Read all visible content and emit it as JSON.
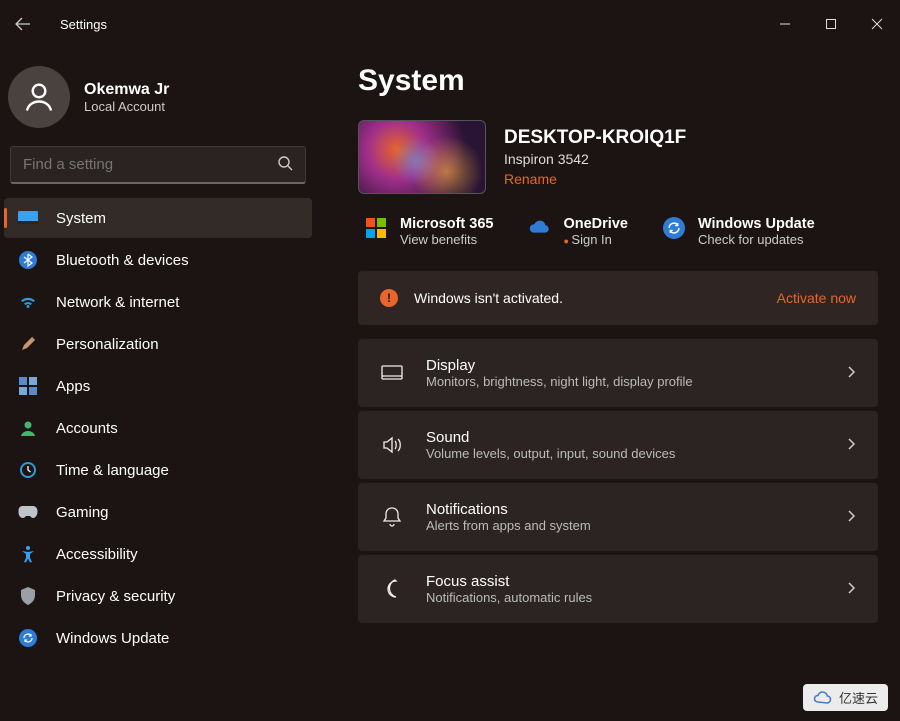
{
  "titlebar": {
    "title": "Settings"
  },
  "profile": {
    "name": "Okemwa Jr",
    "account_type": "Local Account"
  },
  "search": {
    "placeholder": "Find a setting"
  },
  "sidebar": {
    "items": [
      {
        "label": "System"
      },
      {
        "label": "Bluetooth & devices"
      },
      {
        "label": "Network & internet"
      },
      {
        "label": "Personalization"
      },
      {
        "label": "Apps"
      },
      {
        "label": "Accounts"
      },
      {
        "label": "Time & language"
      },
      {
        "label": "Gaming"
      },
      {
        "label": "Accessibility"
      },
      {
        "label": "Privacy & security"
      },
      {
        "label": "Windows Update"
      }
    ],
    "selected_index": 0
  },
  "page": {
    "title": "System"
  },
  "device": {
    "name": "DESKTOP-KROIQ1F",
    "model": "Inspiron 3542",
    "rename_label": "Rename"
  },
  "links": {
    "m365": {
      "title": "Microsoft 365",
      "sub": "View benefits"
    },
    "onedrive": {
      "title": "OneDrive",
      "sub": "Sign In"
    },
    "update": {
      "title": "Windows Update",
      "sub": "Check for updates"
    }
  },
  "activation": {
    "message": "Windows isn't activated.",
    "action": "Activate now"
  },
  "settings_list": [
    {
      "title": "Display",
      "sub": "Monitors, brightness, night light, display profile"
    },
    {
      "title": "Sound",
      "sub": "Volume levels, output, input, sound devices"
    },
    {
      "title": "Notifications",
      "sub": "Alerts from apps and system"
    },
    {
      "title": "Focus assist",
      "sub": "Notifications, automatic rules"
    }
  ],
  "watermark": "亿速云"
}
